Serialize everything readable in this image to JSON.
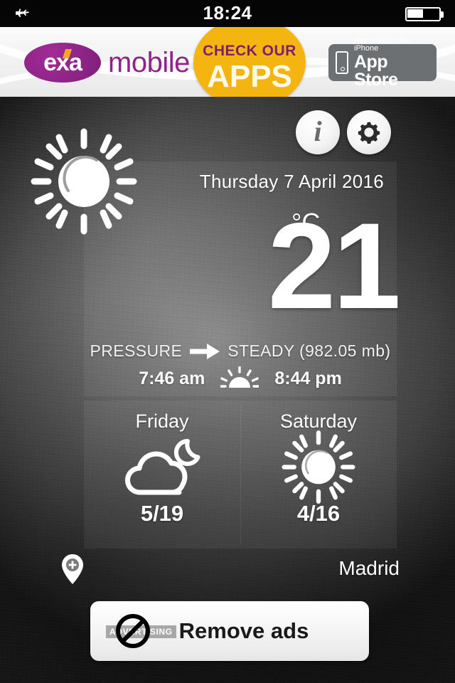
{
  "statusbar": {
    "time": "18:24",
    "airplane_icon": "airplane-icon",
    "battery_icon": "battery-half-icon",
    "battery_level_pct": 50
  },
  "ad_banner": {
    "brand_mark": "exa",
    "brand_word": "mobile",
    "badge_line1": "CHECK OUR",
    "badge_line2": "APPS",
    "appstore_line1": "Available on the iPhone",
    "appstore_line2": "App Store",
    "colors": {
      "purple": "#8e2487",
      "yellow": "#f5b510",
      "badge_text": "#7d1f6b",
      "appstore_grey": "#6d7073"
    }
  },
  "toolbar": {
    "info_label": "i",
    "info_icon": "info-icon",
    "settings_icon": "gear-icon"
  },
  "current": {
    "condition_icon": "sun-icon",
    "date": "Thursday 7 April 2016",
    "temperature": "21",
    "unit": "°C",
    "pressure_label": "PRESSURE",
    "pressure_trend_icon": "arrow-right-icon",
    "pressure_value": "STEADY (982.05 mb)",
    "sunrise": "7:46 am",
    "sunset": "8:44 pm",
    "sun_times_icon": "sunrise-icon"
  },
  "forecast": [
    {
      "day": "Friday",
      "icon": "cloud-moon-icon",
      "temps": "5/19"
    },
    {
      "day": "Saturday",
      "icon": "sun-icon",
      "temps": "4/16"
    }
  ],
  "location": {
    "city": "Madrid",
    "add_icon": "map-pin-plus-icon"
  },
  "remove_ads": {
    "label": "Remove ads",
    "advertising_tag": "ADVERTISING",
    "icon": "no-entry-icon"
  }
}
